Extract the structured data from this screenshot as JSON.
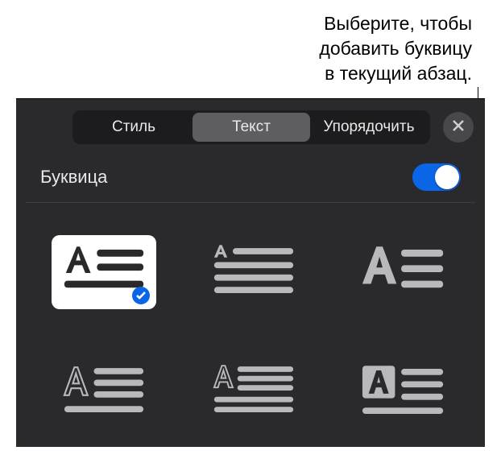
{
  "callout": {
    "line1": "Выберите, чтобы",
    "line2": "добавить буквицу",
    "line3": "в текущий абзац."
  },
  "tabs": {
    "style": "Стиль",
    "text": "Текст",
    "arrange": "Упорядочить",
    "active": "text"
  },
  "section": {
    "dropcap_label": "Буквица",
    "dropcap_enabled": true
  },
  "dropcap_styles": {
    "selected_index": 0,
    "options": [
      {
        "id": "2line-raised"
      },
      {
        "id": "3line-top-small"
      },
      {
        "id": "3line-left-bold"
      },
      {
        "id": "4line-outline"
      },
      {
        "id": "5line-outline"
      },
      {
        "id": "boxed"
      }
    ]
  },
  "colors": {
    "accent": "#0a66e6"
  }
}
